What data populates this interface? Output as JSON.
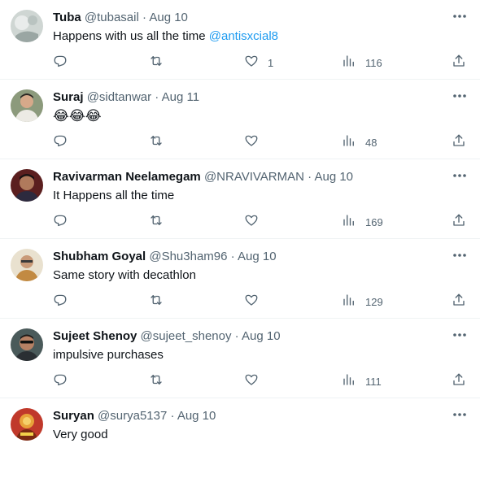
{
  "colors": {
    "text": "#0f1419",
    "secondary": "#536471",
    "link": "#1d9bf0",
    "divider": "#eff3f4"
  },
  "tweets": [
    {
      "name": "Tuba",
      "handle": "@tubasail",
      "separator": "·",
      "date": "Aug 10",
      "text": "Happens with us all the time ",
      "mention": "@antisxcial8",
      "likes": "1",
      "views": "116",
      "avatar_icon": "avatar-photo"
    },
    {
      "name": "Suraj",
      "handle": "@sidtanwar",
      "separator": "·",
      "date": "Aug 11",
      "text": "😂😂😂",
      "mention": "",
      "likes": "",
      "views": "48",
      "avatar_icon": "avatar-photo"
    },
    {
      "name": "Ravivarman Neelamegam",
      "handle": "@NRAVIVARMAN",
      "separator": "·",
      "date": "Aug 10",
      "text": "It Happens all the time",
      "mention": "",
      "likes": "",
      "views": "169",
      "avatar_icon": "avatar-photo"
    },
    {
      "name": "Shubham Goyal",
      "handle": "@Shu3ham96",
      "separator": "·",
      "date": "Aug 10",
      "text": "Same story with decathlon",
      "mention": "",
      "likes": "",
      "views": "129",
      "avatar_icon": "avatar-photo"
    },
    {
      "name": "Sujeet Shenoy",
      "handle": "@sujeet_shenoy",
      "separator": "·",
      "date": "Aug 10",
      "text": "impulsive purchases",
      "mention": "",
      "likes": "",
      "views": "111",
      "avatar_icon": "avatar-photo"
    },
    {
      "name": "Suryan",
      "handle": "@surya5137",
      "separator": "·",
      "date": "Aug 10",
      "text": "Very good",
      "mention": "",
      "likes": "",
      "views": "",
      "avatar_icon": "avatar-photo"
    }
  ]
}
